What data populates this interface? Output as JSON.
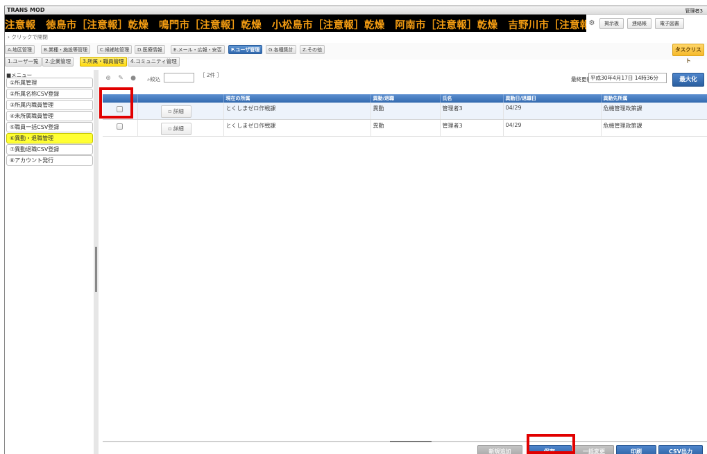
{
  "app": {
    "title": "TRANS MOD",
    "user": "管理者3"
  },
  "ticker": {
    "text": "注意報　徳島市［注意報］乾燥　鳴門市［注意報］乾燥　小松島市［注意報］乾燥　阿南市［注意報］乾燥　吉野川市［注意報］乾燥　阿波市"
  },
  "top_buttons": {
    "bulletin": "掲示板",
    "contact": "連絡帳",
    "library": "電子図書"
  },
  "quickbar": {
    "label": "クリックで開閉"
  },
  "main_tabs": [
    {
      "label": "A.地区管理"
    },
    {
      "label": "B.業種・施設等管理"
    },
    {
      "label": "C.候補地管理"
    },
    {
      "label": "D.医療情報"
    },
    {
      "label": "E.メール・広報・安否"
    },
    {
      "label": "F.ユーザ管理",
      "active": true
    },
    {
      "label": "G.各種集計"
    },
    {
      "label": "Z.その他"
    }
  ],
  "tasklist": {
    "label": "タスクリスト"
  },
  "sub_tabs": [
    {
      "label": "1.ユーザ一覧"
    },
    {
      "label": "2.企業管理"
    },
    {
      "label": "3.所属・職員管理",
      "active": true
    },
    {
      "label": "4.コミュニティ管理"
    }
  ],
  "sidebar": {
    "header": "■メニュー",
    "items": [
      {
        "label": "①所属管理"
      },
      {
        "label": "②所属名称CSV登録"
      },
      {
        "label": "③所属内職員管理"
      },
      {
        "label": "④未所属職員管理"
      },
      {
        "label": "⑤職員一括CSV登録"
      },
      {
        "label": "⑥異動・退職管理",
        "active": true
      },
      {
        "label": "⑦異動退職CSV登録"
      },
      {
        "label": "⑧アカウント発行"
      }
    ]
  },
  "toolbar": {
    "filter_label": "絞込",
    "filter_value": "",
    "count": "［ 2件 ］",
    "updated_label": "最終更新日",
    "updated_value": "平成30年4月17日 14時36分",
    "maximize": "最大化"
  },
  "grid": {
    "columns": [
      "",
      "",
      "現在の所属",
      "異動/退職",
      "氏名",
      "異動日/退職日",
      "異動先所属"
    ],
    "rows": [
      {
        "detail": "詳細",
        "current": "とくしまゼロ作戦課",
        "type": "異動",
        "name": "管理者3",
        "date": "04/29",
        "dest": "危機管理政策課"
      },
      {
        "detail": "詳細",
        "current": "とくしまゼロ作戦課",
        "type": "異動",
        "name": "管理者3",
        "date": "04/29",
        "dest": "危機管理政策課"
      }
    ]
  },
  "bottom_buttons": {
    "add": "新規追加",
    "save": "保存",
    "bulk": "一括変更",
    "print": "印刷",
    "csv": "CSV出力"
  },
  "colors": {
    "ticker_text": "#f39c12",
    "tab_active": "#3a72b8",
    "subtab_active": "#ffe418",
    "menu_active": "#ffff33",
    "highlight": "#e10000"
  }
}
